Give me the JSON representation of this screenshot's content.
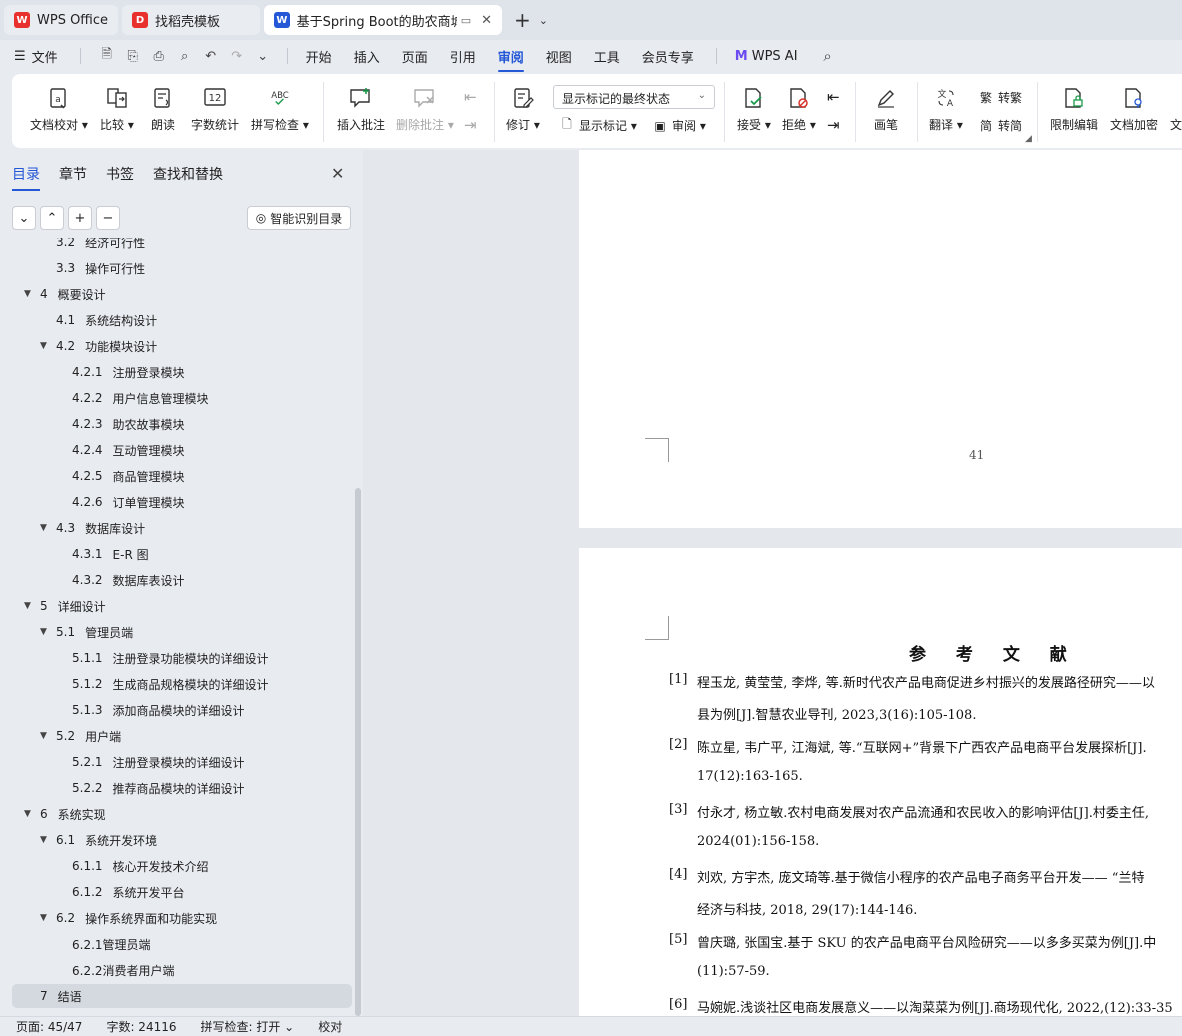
{
  "tabs": [
    {
      "label": "WPS Office",
      "logo": "W",
      "color": "#e8302c"
    },
    {
      "label": "找稻壳模板",
      "logo": "D",
      "color": "#e8302c"
    },
    {
      "label": "基于Spring Boot的助农商城的",
      "logo": "W",
      "color": "#2458d6"
    }
  ],
  "menu": {
    "file": "文件",
    "items": [
      "开始",
      "插入",
      "页面",
      "引用",
      "审阅",
      "视图",
      "工具",
      "会员专享"
    ],
    "active": "审阅",
    "wps_ai": "WPS AI"
  },
  "ribbon": {
    "doc_check": "文档校对",
    "compare": "比较",
    "read_aloud": "朗读",
    "word_count": "字数统计",
    "word_count_icon_text": "12",
    "spell_check": "拼写检查",
    "spell_icon_text": "ABC",
    "insert_comment": "插入批注",
    "delete_comment": "删除批注",
    "revise": "修订",
    "markup_state": "显示标记的最终状态",
    "show_markup": "显示标记",
    "review": "审阅",
    "accept": "接受",
    "reject": "拒绝",
    "pen": "画笔",
    "translate": "翻译",
    "to_traditional": "转繁",
    "to_simplified": "转简",
    "restrict_edit": "限制编辑",
    "encrypt": "文档加密",
    "more": "文"
  },
  "nav": {
    "tabs": [
      "目录",
      "章节",
      "书签",
      "查找和替换"
    ],
    "active_tab": "目录",
    "smart_toc": "智能识别目录",
    "toc": [
      {
        "num": "3.2",
        "title": "经济可行性",
        "level": 2,
        "tri": ""
      },
      {
        "num": "3.3",
        "title": "操作可行性",
        "level": 2,
        "tri": ""
      },
      {
        "num": "4",
        "title": "概要设计",
        "level": 1,
        "tri": "▼"
      },
      {
        "num": "4.1",
        "title": "系统结构设计",
        "level": 2,
        "tri": ""
      },
      {
        "num": "4.2",
        "title": "功能模块设计",
        "level": 2,
        "tri": "▼"
      },
      {
        "num": "4.2.1",
        "title": "注册登录模块",
        "level": 3,
        "tri": ""
      },
      {
        "num": "4.2.2",
        "title": "用户信息管理模块",
        "level": 3,
        "tri": ""
      },
      {
        "num": "4.2.3",
        "title": "助农故事模块",
        "level": 3,
        "tri": ""
      },
      {
        "num": "4.2.4",
        "title": "互动管理模块",
        "level": 3,
        "tri": ""
      },
      {
        "num": "4.2.5",
        "title": "商品管理模块",
        "level": 3,
        "tri": ""
      },
      {
        "num": "4.2.6",
        "title": "订单管理模块",
        "level": 3,
        "tri": ""
      },
      {
        "num": "4.3",
        "title": "数据库设计",
        "level": 2,
        "tri": "▼"
      },
      {
        "num": "4.3.1",
        "title": "E-R 图",
        "level": 3,
        "tri": ""
      },
      {
        "num": "4.3.2",
        "title": "数据库表设计",
        "level": 3,
        "tri": ""
      },
      {
        "num": "5",
        "title": "详细设计",
        "level": 1,
        "tri": "▼"
      },
      {
        "num": "5.1",
        "title": "管理员端",
        "level": 2,
        "tri": "▼"
      },
      {
        "num": "5.1.1",
        "title": "注册登录功能模块的详细设计",
        "level": 3,
        "tri": ""
      },
      {
        "num": "5.1.2",
        "title": "生成商品规格模块的详细设计",
        "level": 3,
        "tri": ""
      },
      {
        "num": "5.1.3",
        "title": "添加商品模块的详细设计",
        "level": 3,
        "tri": ""
      },
      {
        "num": "5.2",
        "title": "用户端",
        "level": 2,
        "tri": "▼"
      },
      {
        "num": "5.2.1",
        "title": "注册登录模块的详细设计",
        "level": 3,
        "tri": ""
      },
      {
        "num": "5.2.2",
        "title": "推荐商品模块的详细设计",
        "level": 3,
        "tri": ""
      },
      {
        "num": "6",
        "title": "系统实现",
        "level": 1,
        "tri": "▼"
      },
      {
        "num": "6.1",
        "title": "系统开发环境",
        "level": 2,
        "tri": "▼"
      },
      {
        "num": "6.1.1",
        "title": "核心开发技术介绍",
        "level": 3,
        "tri": ""
      },
      {
        "num": "6.1.2",
        "title": "系统开发平台",
        "level": 3,
        "tri": ""
      },
      {
        "num": "6.2",
        "title": "操作系统界面和功能实现",
        "level": 2,
        "tri": "▼"
      },
      {
        "num": "",
        "title": "6.2.1管理员端",
        "level": 3,
        "tri": ""
      },
      {
        "num": "",
        "title": "6.2.2消费者用户端",
        "level": 3,
        "tri": ""
      },
      {
        "num": "7",
        "title": "结语",
        "level": 1,
        "tri": "",
        "selected": true
      }
    ]
  },
  "doc": {
    "page_number": "41",
    "refs_title": "参 考 文 献",
    "refs": [
      {
        "idx": "[1]",
        "lines": [
          "程玉龙, 黄莹莹, 李烨, 等.新时代农产品电商促进乡村振兴的发展路径研究——以",
          "县为例[J].智慧农业导刊, 2023,3(16):105-108."
        ]
      },
      {
        "idx": "[2]",
        "lines": [
          "陈立星, 韦广平, 江海斌, 等.“互联网+”背景下广西农产品电商平台发展探析[J].",
          "17(12):163-165."
        ]
      },
      {
        "idx": "[3]",
        "lines": [
          "付永才, 杨立敏.农村电商发展对农产品流通和农民收入的影响评估[J].村委主任,",
          "2024(01):156-158."
        ]
      },
      {
        "idx": "[4]",
        "lines": [
          "刘欢, 方宇杰, 庞文琦等.基于微信小程序的农产品电子商务平台开发—— “兰特",
          "经济与科技, 2018, 29(17):144-146."
        ]
      },
      {
        "idx": "[5]",
        "lines": [
          "曾庆璐, 张国宝.基于 SKU 的农产品电商平台风险研究——以多多买菜为例[J].中",
          "(11):57-59."
        ]
      },
      {
        "idx": "[6]",
        "lines": [
          "马婉妮.浅谈社区电商发展意义——以淘菜菜为例[J].商场现代化, 2022,(12):33-35"
        ]
      }
    ]
  },
  "status": {
    "page": "页面: 45/47",
    "words": "字数: 24116",
    "spell": "拼写检查: 打开",
    "proof": "校对"
  }
}
